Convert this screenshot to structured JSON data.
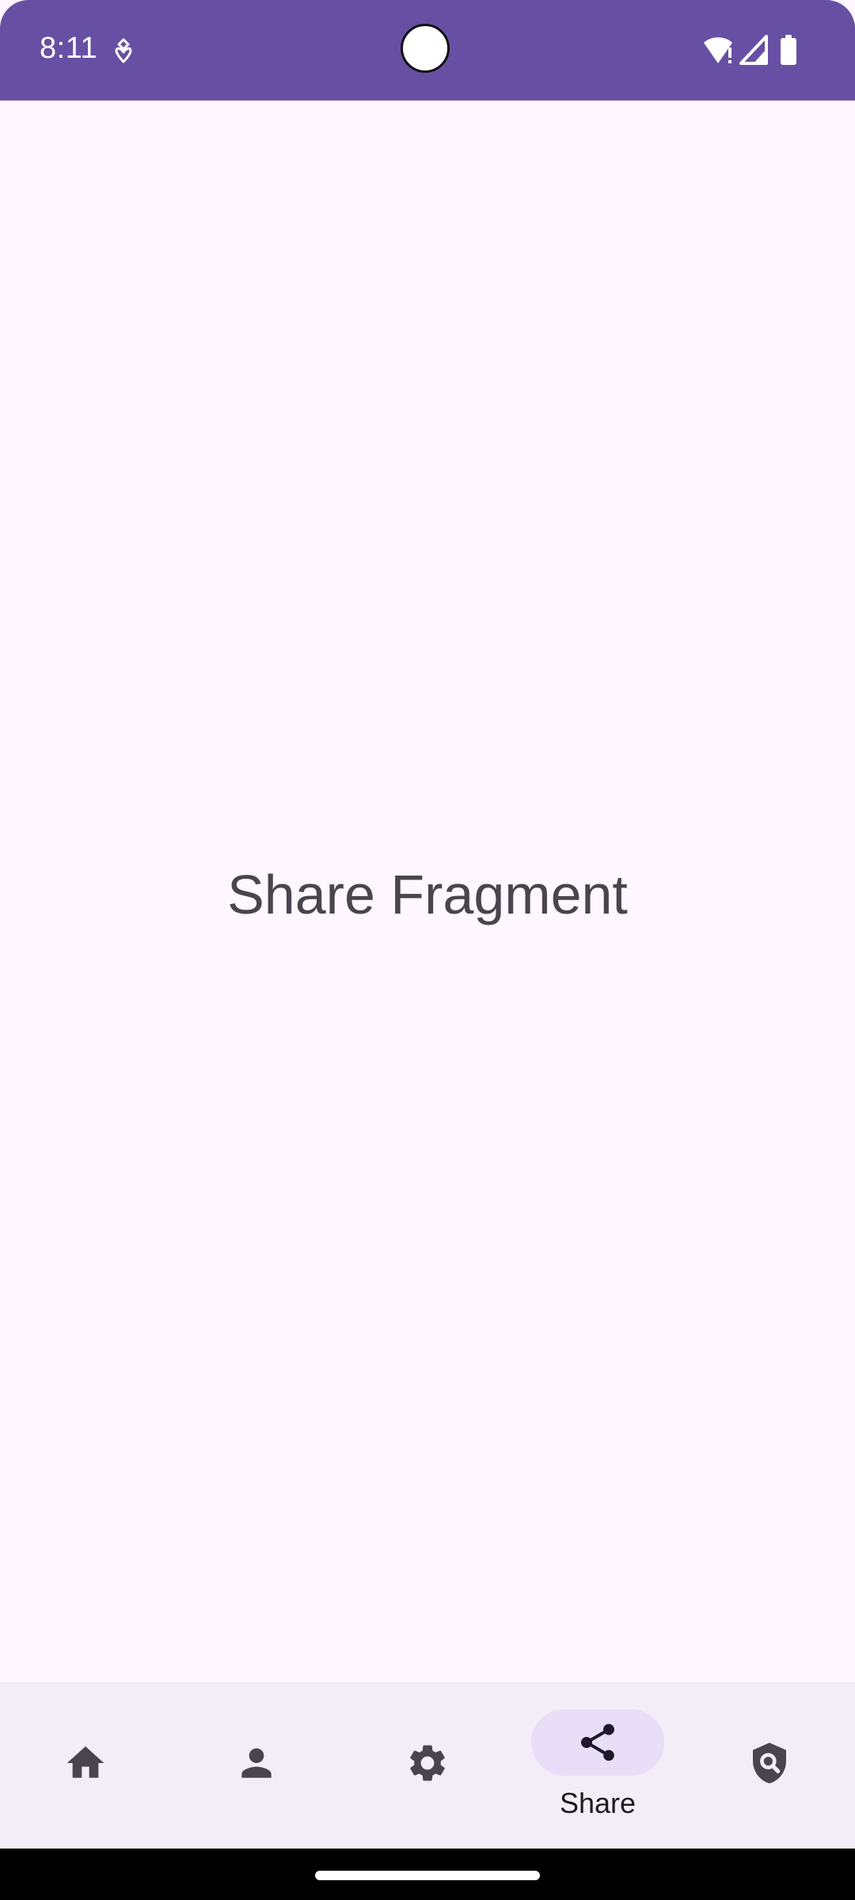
{
  "status_bar": {
    "time": "8:11",
    "icons": [
      "notification-icon",
      "wifi-alert-icon",
      "signal-icon",
      "battery-icon"
    ]
  },
  "main": {
    "fragment_text": "Share Fragment"
  },
  "bottom_nav": {
    "items": [
      {
        "icon": "home-icon",
        "label": ""
      },
      {
        "icon": "person-icon",
        "label": ""
      },
      {
        "icon": "settings-icon",
        "label": ""
      },
      {
        "icon": "share-icon",
        "label": "Share",
        "active": true
      },
      {
        "icon": "privacy-search-icon",
        "label": ""
      }
    ]
  },
  "colors": {
    "status_bar": "#6750A4",
    "background": "#FEF7FF",
    "nav_background": "#F3EDF7",
    "active_indicator": "#E8DEF8",
    "icon": "#49454F",
    "active_icon": "#1D192B"
  }
}
